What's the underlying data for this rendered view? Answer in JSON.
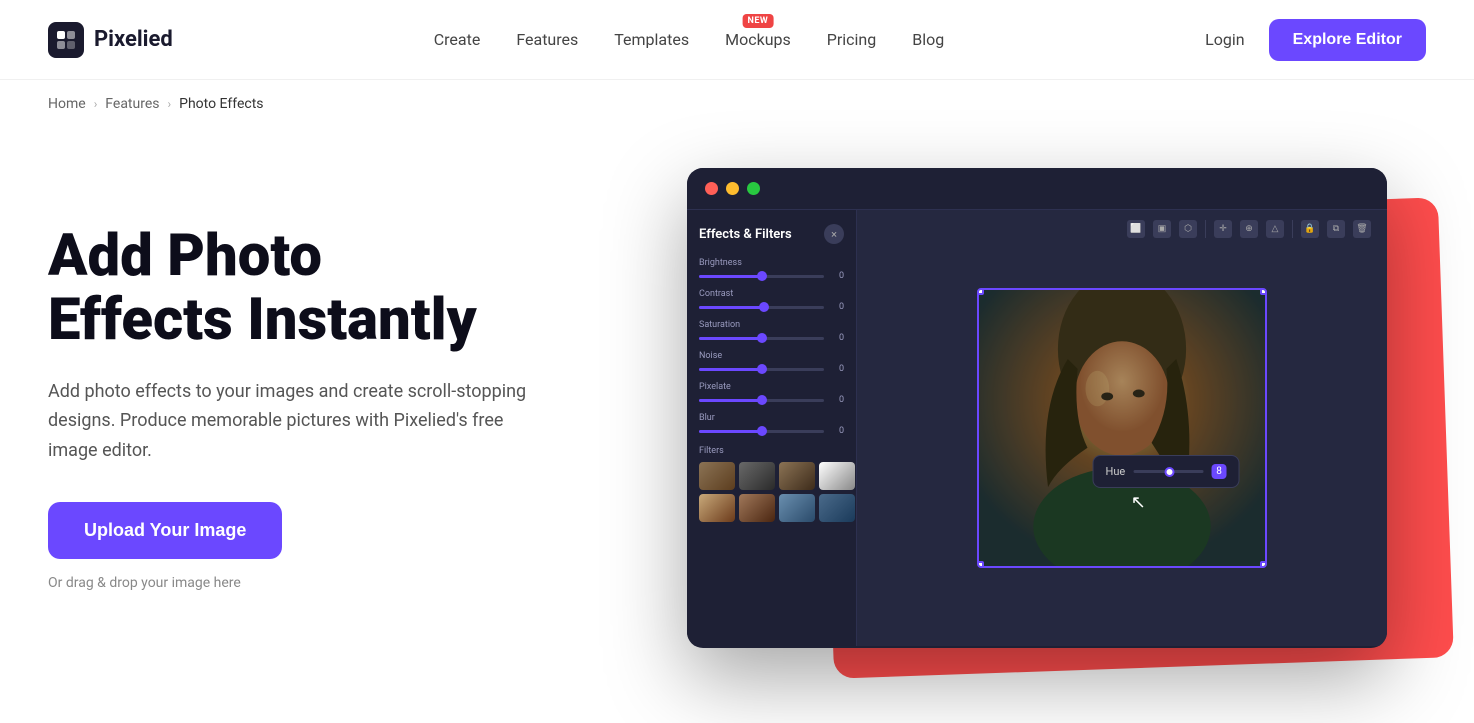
{
  "header": {
    "logo_text": "Pixelied",
    "logo_symbol": "▶|",
    "nav": [
      {
        "label": "Create",
        "id": "create",
        "badge": null
      },
      {
        "label": "Features",
        "id": "features",
        "badge": null
      },
      {
        "label": "Templates",
        "id": "templates",
        "badge": null
      },
      {
        "label": "Mockups",
        "id": "mockups",
        "badge": "NEW"
      },
      {
        "label": "Pricing",
        "id": "pricing",
        "badge": null
      },
      {
        "label": "Blog",
        "id": "blog",
        "badge": null
      }
    ],
    "login_label": "Login",
    "explore_label": "Explore Editor"
  },
  "breadcrumb": {
    "home": "Home",
    "features": "Features",
    "current": "Photo Effects"
  },
  "hero": {
    "title_line1": "Add Photo",
    "title_line2": "Effects Instantly",
    "description": "Add photo effects to your images and create scroll-stopping designs. Produce memorable pictures with Pixelied's free image editor.",
    "upload_btn": "Upload Your Image",
    "drag_drop": "Or drag & drop your image here"
  },
  "editor": {
    "panel_title": "Effects & Filters",
    "sliders": [
      {
        "label": "Brightness",
        "value": "0",
        "fill_pct": 50
      },
      {
        "label": "Contrast",
        "value": "0",
        "fill_pct": 50
      },
      {
        "label": "Saturation",
        "value": "0",
        "fill_pct": 50
      },
      {
        "label": "Noise",
        "value": "0",
        "fill_pct": 50
      },
      {
        "label": "Pixelate",
        "value": "0",
        "fill_pct": 50
      },
      {
        "label": "Blur",
        "value": "0",
        "fill_pct": 50
      }
    ],
    "filters_label": "Filters",
    "hue": {
      "label": "Hue",
      "value": "8"
    }
  },
  "colors": {
    "accent": "#6b48ff",
    "accent_hover": "#5a38ee",
    "badge_bg": "#ef4444",
    "editor_bg": "#1e2035",
    "selection_border": "#6b48ff"
  }
}
